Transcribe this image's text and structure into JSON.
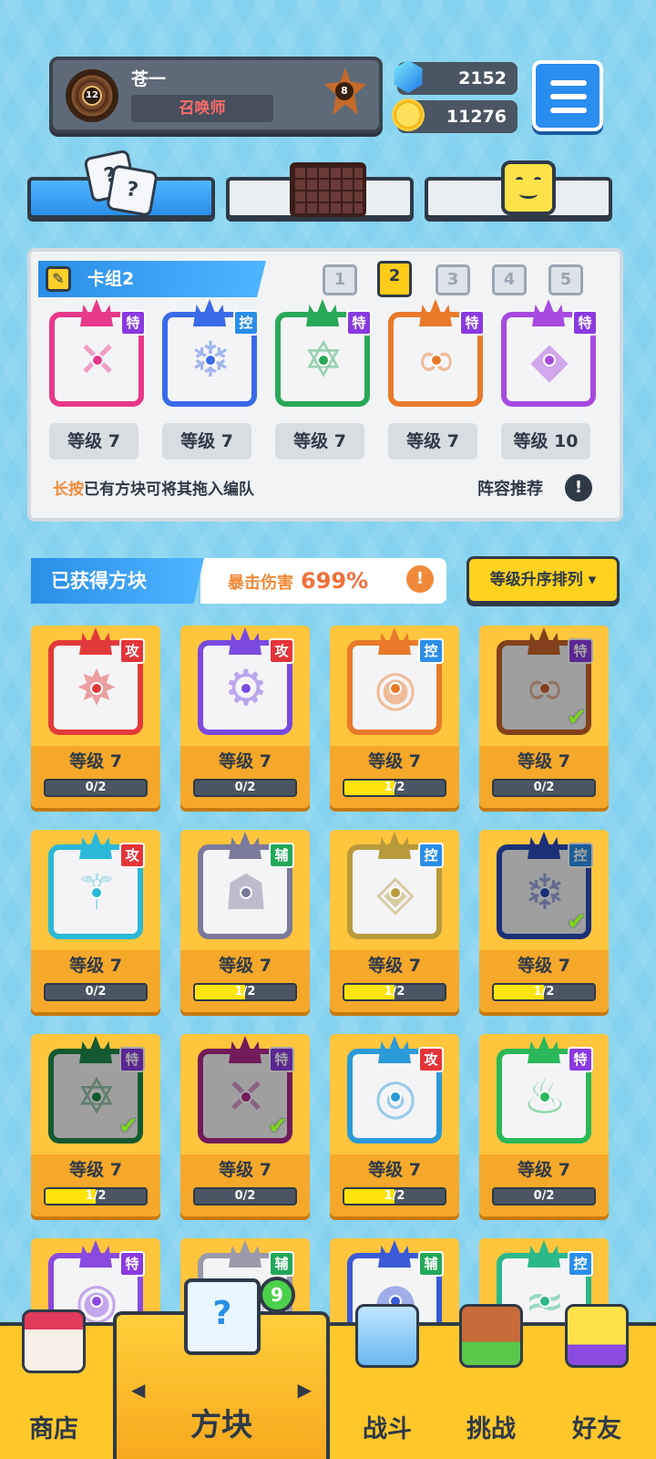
{
  "profile": {
    "name": "苍一",
    "title": "召唤师",
    "level": "12",
    "rank": "8"
  },
  "currency": {
    "gems": "2152",
    "coins": "11276"
  },
  "deck": {
    "name": "卡组2",
    "tabs": [
      "1",
      "2",
      "3",
      "4",
      "5"
    ],
    "active_tab": "2",
    "slots": [
      {
        "tag": "特",
        "level": "等级 7",
        "color": "#e8388a",
        "mark": "✕"
      },
      {
        "tag": "控",
        "level": "等级 7",
        "color": "#3a6ae8",
        "mark": "❄"
      },
      {
        "tag": "特",
        "level": "等级 7",
        "color": "#2aa85a",
        "mark": "✡"
      },
      {
        "tag": "特",
        "level": "等级 7",
        "color": "#e87a2a",
        "mark": "∞"
      },
      {
        "tag": "特",
        "level": "等级 10",
        "color": "#a64ae0",
        "mark": "◆"
      }
    ],
    "hint_strong": "长按",
    "hint_rest": "已有方块可将其拖入编队",
    "recommend": "阵容推荐"
  },
  "owned": {
    "header": "已获得方块",
    "crit_label": "暴击伤害",
    "crit_value": "699%",
    "sort_label": "等级升序排列",
    "cards": [
      {
        "tag": "攻",
        "tagtype": "atk",
        "level": "等级 7",
        "progress": "0/2",
        "fill": 0,
        "color": "#e23a3a",
        "mark": "✸",
        "inDeck": false
      },
      {
        "tag": "攻",
        "tagtype": "atk",
        "level": "等级 7",
        "progress": "0/2",
        "fill": 0,
        "color": "#7a4ae0",
        "mark": "⚙",
        "inDeck": false
      },
      {
        "tag": "控",
        "tagtype": "ctl",
        "level": "等级 7",
        "progress": "1/2",
        "fill": 0.5,
        "color": "#e87a2a",
        "mark": "◉",
        "inDeck": false
      },
      {
        "tag": "特",
        "tagtype": "spc",
        "level": "等级 7",
        "progress": "0/2",
        "fill": 0,
        "color": "#c8642a",
        "mark": "∞",
        "inDeck": true
      },
      {
        "tag": "攻",
        "tagtype": "atk",
        "level": "等级 7",
        "progress": "0/2",
        "fill": 0,
        "color": "#2ab8d8",
        "mark": "⚚",
        "inDeck": false
      },
      {
        "tag": "辅",
        "tagtype": "sup",
        "level": "等级 7",
        "progress": "1/2",
        "fill": 0.5,
        "color": "#7a7a9a",
        "mark": "☗",
        "inDeck": false
      },
      {
        "tag": "控",
        "tagtype": "ctl",
        "level": "等级 7",
        "progress": "1/2",
        "fill": 0.5,
        "color": "#b89a3a",
        "mark": "◈",
        "inDeck": false
      },
      {
        "tag": "控",
        "tagtype": "ctl",
        "level": "等级 7",
        "progress": "1/2",
        "fill": 0.5,
        "color": "#2a4ab8",
        "mark": "❄",
        "inDeck": true
      },
      {
        "tag": "特",
        "tagtype": "spc",
        "level": "等级 7",
        "progress": "1/2",
        "fill": 0.5,
        "color": "#1e8a4a",
        "mark": "✡",
        "inDeck": true
      },
      {
        "tag": "特",
        "tagtype": "spc",
        "level": "等级 7",
        "progress": "0/2",
        "fill": 0,
        "color": "#b02a8a",
        "mark": "✕",
        "inDeck": true
      },
      {
        "tag": "攻",
        "tagtype": "atk",
        "level": "等级 7",
        "progress": "1/2",
        "fill": 0.5,
        "color": "#2a9ad8",
        "mark": "◎",
        "inDeck": false
      },
      {
        "tag": "特",
        "tagtype": "spc",
        "level": "等级 7",
        "progress": "0/2",
        "fill": 0,
        "color": "#2ab85a",
        "mark": "♨",
        "inDeck": false
      },
      {
        "tag": "特",
        "tagtype": "spc",
        "color": "#8a4ae0",
        "mark": "◉"
      },
      {
        "tag": "辅",
        "tagtype": "sup",
        "color": "#9a9aaa",
        "mark": "◍"
      },
      {
        "tag": "辅",
        "tagtype": "sup",
        "color": "#3a5ad8",
        "mark": "◓"
      },
      {
        "tag": "控",
        "tagtype": "ctl",
        "color": "#2ab88a",
        "mark": "≈"
      }
    ]
  },
  "nav": {
    "shop": "商店",
    "blocks": "方块",
    "battle": "战斗",
    "challenge": "挑战",
    "friends": "好友",
    "blocks_badge": "9"
  }
}
